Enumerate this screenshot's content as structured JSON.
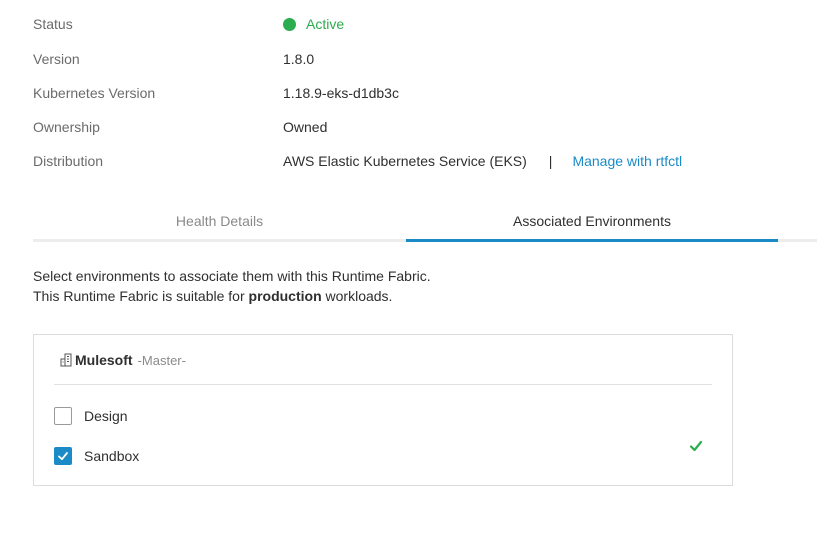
{
  "info": {
    "status_label": "Status",
    "status_value": "Active",
    "version_label": "Version",
    "version_value": "1.8.0",
    "k8s_label": "Kubernetes Version",
    "k8s_value": "1.18.9-eks-d1db3c",
    "ownership_label": "Ownership",
    "ownership_value": "Owned",
    "distribution_label": "Distribution",
    "distribution_value": "AWS Elastic Kubernetes Service (EKS)",
    "distribution_separator": "|",
    "manage_link": "Manage with rtfctl"
  },
  "tabs": [
    {
      "label": "Health Details",
      "selected": false
    },
    {
      "label": "Associated Environments",
      "selected": true
    }
  ],
  "description": {
    "line1": "Select environments to associate them with this Runtime Fabric.",
    "line2_prefix": "This Runtime Fabric is suitable for ",
    "line2_bold": "production",
    "line2_suffix": " workloads."
  },
  "organization": {
    "name": "Mulesoft",
    "role": "-Master-",
    "icon": "organization-icon",
    "environments": [
      {
        "name": "Design",
        "checked": false
      },
      {
        "name": "Sandbox",
        "checked": true,
        "associated": true
      }
    ]
  },
  "colors": {
    "active_green": "#2bad4f",
    "accent_blue": "#1a8bc7"
  }
}
